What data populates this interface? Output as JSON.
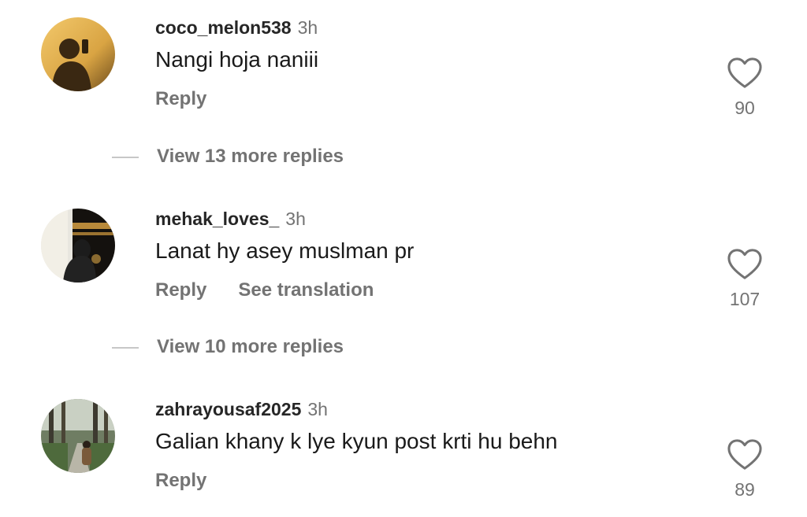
{
  "comments": [
    {
      "username": "coco_melon538",
      "time": "3h",
      "text": "Nangi hoja naniii",
      "reply_label": "Reply",
      "likes": "90",
      "avatar": "woman-silhouette-warm-photo"
    },
    {
      "username": "mehak_loves_",
      "time": "3h",
      "text": "Lanat hy asey muslman pr",
      "reply_label": "Reply",
      "translation_label": "See translation",
      "likes": "107",
      "avatar": "woman-in-abaya-at-kaaba-photo"
    },
    {
      "username": "zahrayousaf2025",
      "time": "3h",
      "text": "Galian khany k lye kyun post krti hu behn",
      "reply_label": "Reply",
      "likes": "89",
      "avatar": "woman-on-forest-path-photo"
    }
  ],
  "replies": [
    {
      "label": "View 13 more replies"
    },
    {
      "label": "View 10 more replies"
    }
  ],
  "icons": {
    "like": "heart-outline-icon"
  },
  "colors": {
    "username": "#262626",
    "secondary": "#737373",
    "divider": "#c7c7c7"
  }
}
